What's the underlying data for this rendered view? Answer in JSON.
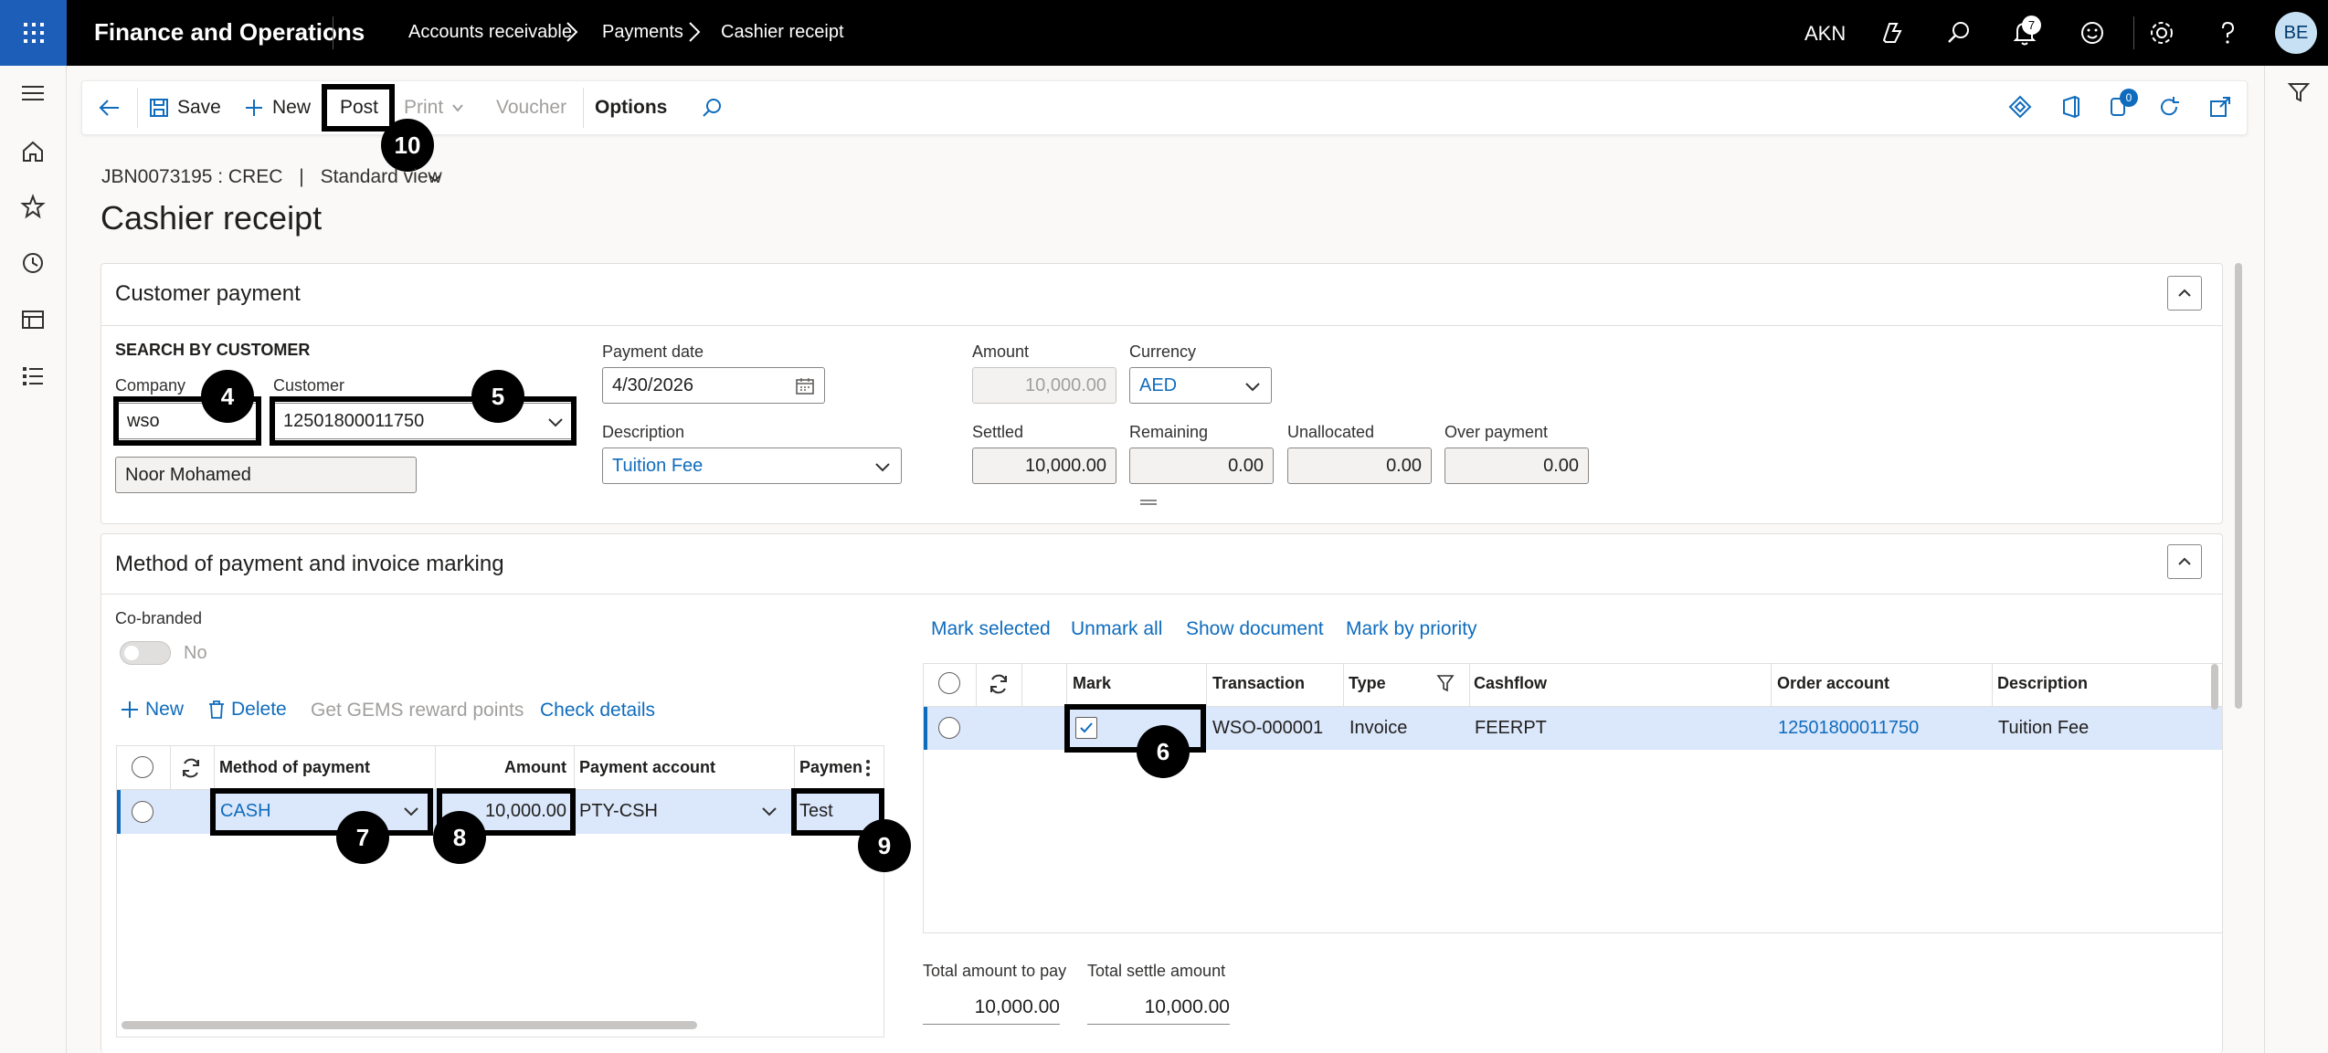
{
  "app": {
    "title": "Finance and Operations",
    "company": "AKN",
    "avatar_initials": "BE",
    "notification_count": "7"
  },
  "breadcrumb": [
    "Accounts receivable",
    "Payments",
    "Cashier receipt"
  ],
  "action_pane": {
    "save": "Save",
    "new": "New",
    "post": "Post",
    "print": "Print",
    "voucher": "Voucher",
    "options": "Options",
    "attachments_badge": "0"
  },
  "header": {
    "record_id": "JBN0073195 : CREC",
    "separator": "|",
    "view": "Standard view",
    "title": "Cashier receipt"
  },
  "customer_payment": {
    "section_title": "Customer payment",
    "search_heading": "SEARCH BY CUSTOMER",
    "company_label": "Company",
    "company_value": "wso",
    "customer_label": "Customer",
    "customer_value": "12501800011750",
    "customer_name": "Noor Mohamed",
    "payment_date_label": "Payment date",
    "payment_date_value": "4/30/2026",
    "description_label": "Description",
    "description_value": "Tuition Fee",
    "amount_label": "Amount",
    "amount_value": "10,000.00",
    "currency_label": "Currency",
    "currency_value": "AED",
    "settled_label": "Settled",
    "settled_value": "10,000.00",
    "remaining_label": "Remaining",
    "remaining_value": "0.00",
    "unallocated_label": "Unallocated",
    "unallocated_value": "0.00",
    "overpayment_label": "Over payment",
    "overpayment_value": "0.00"
  },
  "method_section": {
    "section_title": "Method of payment and invoice marking",
    "cobranded_label": "Co-branded",
    "cobranded_value": "No",
    "toolbar": {
      "new": "New",
      "delete": "Delete",
      "gems": "Get GEMS reward points",
      "check": "Check details"
    },
    "columns": {
      "method": "Method of payment",
      "amount": "Amount",
      "account": "Payment account",
      "payment": "Paymen"
    },
    "rows": [
      {
        "method": "CASH",
        "amount": "10,000.00",
        "account": "PTY-CSH",
        "payment": "Test"
      }
    ]
  },
  "invoice_grid": {
    "toolbar": {
      "mark_selected": "Mark selected",
      "unmark_all": "Unmark all",
      "show_document": "Show document",
      "mark_priority": "Mark by priority"
    },
    "columns": {
      "mark": "Mark",
      "transaction": "Transaction",
      "type": "Type",
      "cashflow": "Cashflow",
      "order_account": "Order account",
      "description": "Description"
    },
    "rows": [
      {
        "mark": true,
        "transaction": "WSO-000001",
        "type": "Invoice",
        "cashflow": "FEERPT",
        "order_account": "12501800011750",
        "description": "Tuition Fee"
      }
    ],
    "total_pay_label": "Total amount to pay",
    "total_pay_value": "10,000.00",
    "total_settle_label": "Total settle amount",
    "total_settle_value": "10,000.00"
  },
  "callouts": [
    "4",
    "5",
    "6",
    "7",
    "8",
    "9",
    "10"
  ],
  "colors": {
    "brand": "#1d5eb8",
    "link": "#0f6cbd",
    "selected_row": "#dbe7fb"
  }
}
